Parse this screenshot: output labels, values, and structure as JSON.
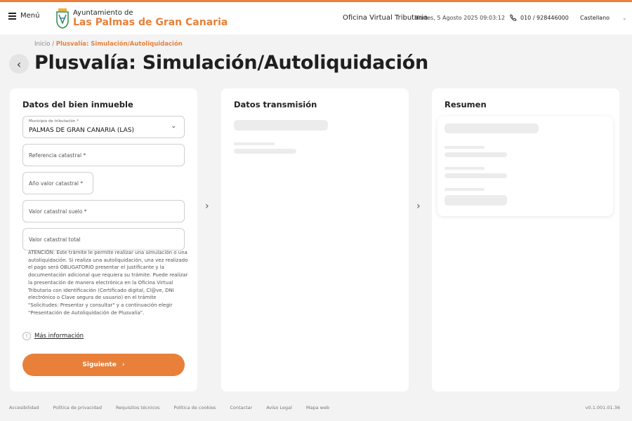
{
  "header": {
    "menu_label": "Menú",
    "logo_top": "Ayuntamiento de",
    "logo_main": "Las Palmas de Gran Canaria",
    "office": "Oficina Virtual Tributaria",
    "datetime": "Martes, 5 Agosto 2025 09:03:12",
    "phone": "010 / 928446000",
    "language": "Castellano",
    "accent_color": "#e8803a"
  },
  "breadcrumb": {
    "home": "Inicio",
    "separator": "/",
    "current": "Plusvalía: Simulación/Autoliquidación"
  },
  "page_title": "Plusvalía: Simulación/Autoliquidación",
  "card1": {
    "title": "Datos del bien inmueble",
    "municipio_label": "Municipio de tributación *",
    "municipio_value": "PALMAS DE GRAN CANARIA (LAS)",
    "ref_catastral": "Referencia catastral *",
    "anio_valor": "Año valor catastral *",
    "valor_suelo": "Valor catastral suelo *",
    "valor_total": "Valor catastral total",
    "notice": "ATENCIÓN: Este trámite le permite realizar una simulación o una autoliquidación. Si realiza una autoliquidación, una vez realizado el pago será OBLIGATORIO presentar el justificante y la documentación adicional que requiera su trámite. Puede realizar la presentación de manera electrónica en la Oficina Virtual Tributaria con identificación (Certificado digital, Cl@ve, DNI electrónico o Clave segura de usuario) en el trámite \"Solicitudes: Presentar y consultar\" y a continuación elegir \"Presentación de Autoliquidación de Plusvalía\".",
    "more_info": "Más información",
    "next_button": "Siguiente"
  },
  "card2": {
    "title": "Datos transmisión"
  },
  "card3": {
    "title": "Resumen"
  },
  "footer": {
    "links": [
      "Accesibilidad",
      "Política de privacidad",
      "Requisitos técnicos",
      "Política de cookies",
      "Contactar",
      "Aviso Legal",
      "Mapa web"
    ],
    "version": "v0.1.001.01.36"
  }
}
